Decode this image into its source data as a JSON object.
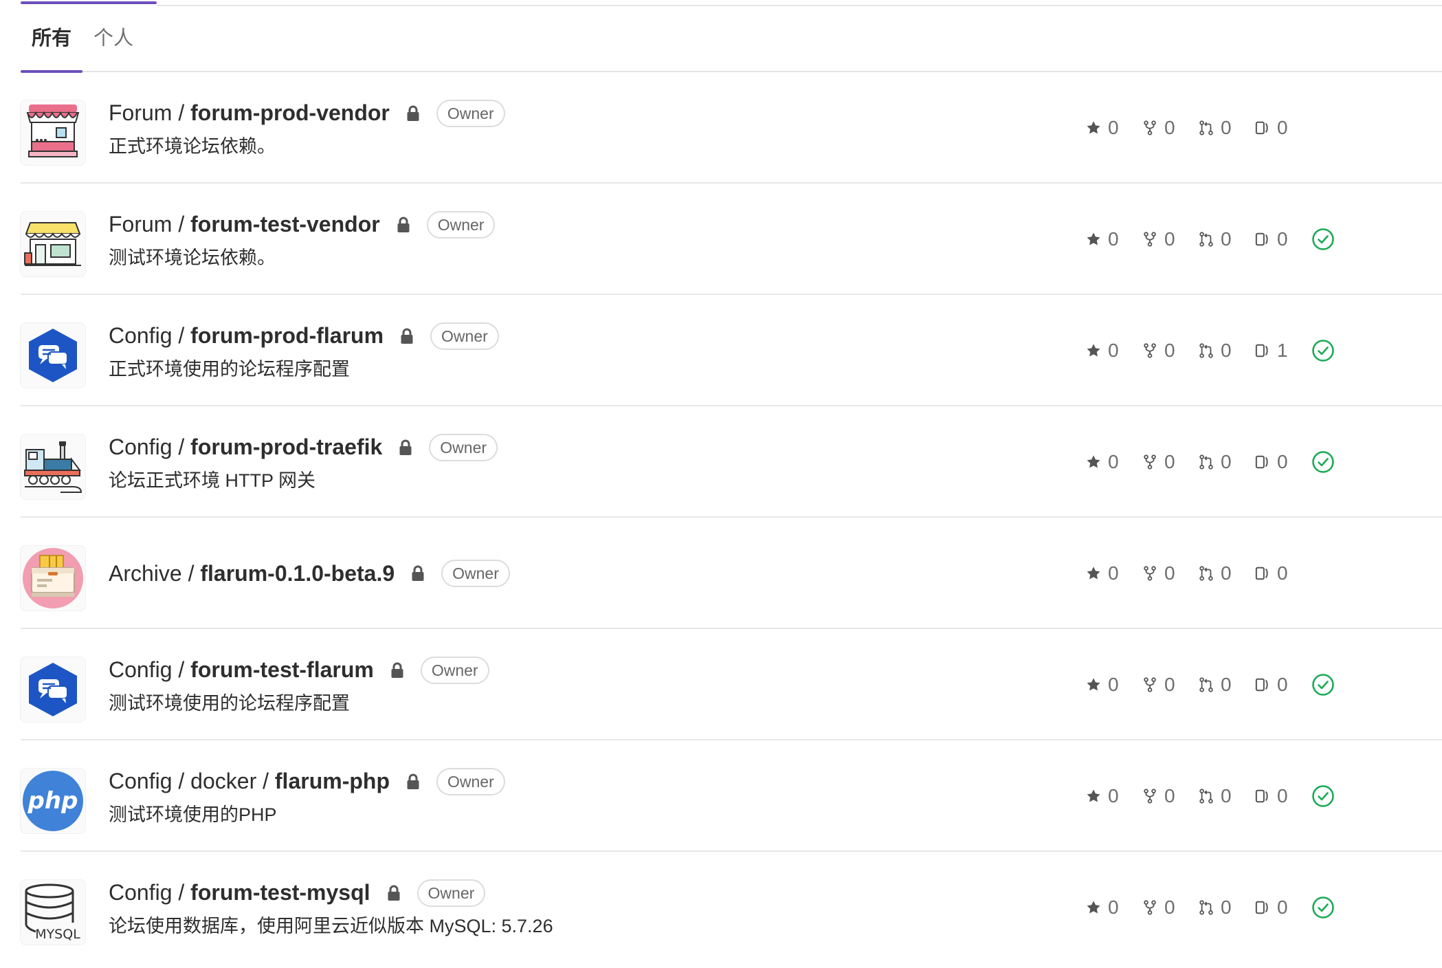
{
  "tabs": [
    {
      "label": "所有",
      "active": true
    },
    {
      "label": "个人",
      "active": false
    }
  ],
  "colors": {
    "accent": "#6b4fbb",
    "success": "#1aaa55",
    "border": "#e5e5e5"
  },
  "projects": [
    {
      "namespace": "Forum / ",
      "name": "forum-prod-vendor",
      "badge": "Owner",
      "description": "正式环境论坛依赖。",
      "avatar": "storefront-icon",
      "stars": "0",
      "forks": "0",
      "merge_requests": "0",
      "issues": "0",
      "pipeline": "none"
    },
    {
      "namespace": "Forum / ",
      "name": "forum-test-vendor",
      "badge": "Owner",
      "description": "测试环境论坛依赖。",
      "avatar": "shop-icon",
      "stars": "0",
      "forks": "0",
      "merge_requests": "0",
      "issues": "0",
      "pipeline": "passed"
    },
    {
      "namespace": "Config / ",
      "name": "forum-prod-flarum",
      "badge": "Owner",
      "description": "正式环境使用的论坛程序配置",
      "avatar": "chat-hexagon-icon",
      "stars": "0",
      "forks": "0",
      "merge_requests": "0",
      "issues": "1",
      "pipeline": "passed"
    },
    {
      "namespace": "Config / ",
      "name": "forum-prod-traefik",
      "badge": "Owner",
      "description": "论坛正式环境 HTTP 网关",
      "avatar": "locomotive-icon",
      "stars": "0",
      "forks": "0",
      "merge_requests": "0",
      "issues": "0",
      "pipeline": "passed"
    },
    {
      "namespace": "Archive / ",
      "name": "flarum-0.1.0-beta.9",
      "badge": "Owner",
      "description": "",
      "avatar": "archive-box-icon",
      "stars": "0",
      "forks": "0",
      "merge_requests": "0",
      "issues": "0",
      "pipeline": "none"
    },
    {
      "namespace": "Config / ",
      "name": "forum-test-flarum",
      "badge": "Owner",
      "description": "测试环境使用的论坛程序配置",
      "avatar": "chat-hexagon-icon",
      "stars": "0",
      "forks": "0",
      "merge_requests": "0",
      "issues": "0",
      "pipeline": "passed"
    },
    {
      "namespace": "Config / docker / ",
      "name": "flarum-php",
      "badge": "Owner",
      "description": "测试环境使用的PHP",
      "avatar": "php-icon",
      "stars": "0",
      "forks": "0",
      "merge_requests": "0",
      "issues": "0",
      "pipeline": "passed"
    },
    {
      "namespace": "Config / ",
      "name": "forum-test-mysql",
      "badge": "Owner",
      "description": "论坛使用数据库，使用阿里云近似版本 MySQL: 5.7.26",
      "avatar": "mysql-database-icon",
      "avatar_label": "MYSQL",
      "stars": "0",
      "forks": "0",
      "merge_requests": "0",
      "issues": "0",
      "pipeline": "passed"
    }
  ]
}
